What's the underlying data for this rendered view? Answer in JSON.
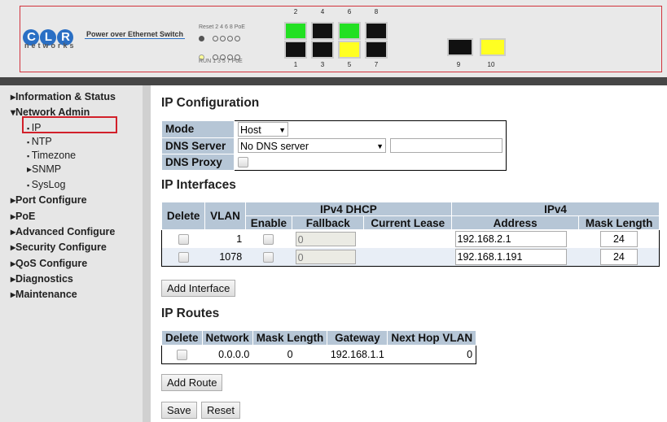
{
  "header": {
    "brand": "CLR",
    "brand_sub": "networks",
    "product": "Power over Ethernet Switch",
    "led_top_labels": [
      "Reset",
      "2",
      "4",
      "6",
      "8",
      "PoE"
    ],
    "led_bottom_labels": [
      "RUN",
      "1",
      "3",
      "5",
      "7",
      "PoE"
    ],
    "ports_top": [
      {
        "n": "2",
        "color": "#22e022"
      },
      {
        "n": "4",
        "color": "#111111"
      },
      {
        "n": "6",
        "color": "#22e022"
      },
      {
        "n": "8",
        "color": "#111111"
      }
    ],
    "ports_bottom": [
      {
        "n": "1",
        "color": "#111111"
      },
      {
        "n": "3",
        "color": "#111111"
      },
      {
        "n": "5",
        "color": "#ffff22"
      },
      {
        "n": "7",
        "color": "#111111"
      }
    ],
    "sfp": [
      {
        "n": "9",
        "color": "#111111"
      },
      {
        "n": "10",
        "color": "#ffff22"
      }
    ]
  },
  "sidebar": {
    "items": [
      {
        "label": "Information & Status",
        "icon": "triangle-right"
      },
      {
        "label": "Network Admin",
        "icon": "triangle-down"
      },
      {
        "label": "IP",
        "icon": "bullet",
        "selected": true
      },
      {
        "label": "NTP",
        "icon": "bullet"
      },
      {
        "label": "Timezone",
        "icon": "bullet"
      },
      {
        "label": "SNMP",
        "icon": "triangle-right"
      },
      {
        "label": "SysLog",
        "icon": "bullet"
      },
      {
        "label": "Port Configure",
        "icon": "triangle-right"
      },
      {
        "label": "PoE",
        "icon": "triangle-right"
      },
      {
        "label": "Advanced Configure",
        "icon": "triangle-right"
      },
      {
        "label": "Security Configure",
        "icon": "triangle-right"
      },
      {
        "label": "QoS Configure",
        "icon": "triangle-right"
      },
      {
        "label": "Diagnostics",
        "icon": "triangle-right"
      },
      {
        "label": "Maintenance",
        "icon": "triangle-right"
      }
    ]
  },
  "ipconfig": {
    "title": "IP Configuration",
    "mode_label": "Mode",
    "mode_value": "Host",
    "dns_label": "DNS Server",
    "dns_value": "No DNS server",
    "dns_text": "",
    "proxy_label": "DNS Proxy"
  },
  "interfaces": {
    "title": "IP Interfaces",
    "h_delete": "Delete",
    "h_vlan": "VLAN",
    "h_dhcp": "IPv4 DHCP",
    "h_ipv4": "IPv4",
    "h_enable": "Enable",
    "h_fallback": "Fallback",
    "h_lease": "Current Lease",
    "h_address": "Address",
    "h_mask": "Mask Length",
    "rows": [
      {
        "vlan": "1",
        "fallback": "0",
        "lease": "",
        "address": "192.168.2.1",
        "mask": "24"
      },
      {
        "vlan": "1078",
        "fallback": "0",
        "lease": "",
        "address": "192.168.1.191",
        "mask": "24"
      }
    ],
    "add_label": "Add Interface"
  },
  "routes": {
    "title": "IP Routes",
    "headers": [
      "Delete",
      "Network",
      "Mask Length",
      "Gateway",
      "Next Hop VLAN"
    ],
    "rows": [
      {
        "network": "0.0.0.0",
        "mask": "0",
        "gateway": "192.168.1.1",
        "nexthop": "0"
      }
    ],
    "add_label": "Add Route"
  },
  "actions": {
    "save": "Save",
    "reset": "Reset"
  }
}
